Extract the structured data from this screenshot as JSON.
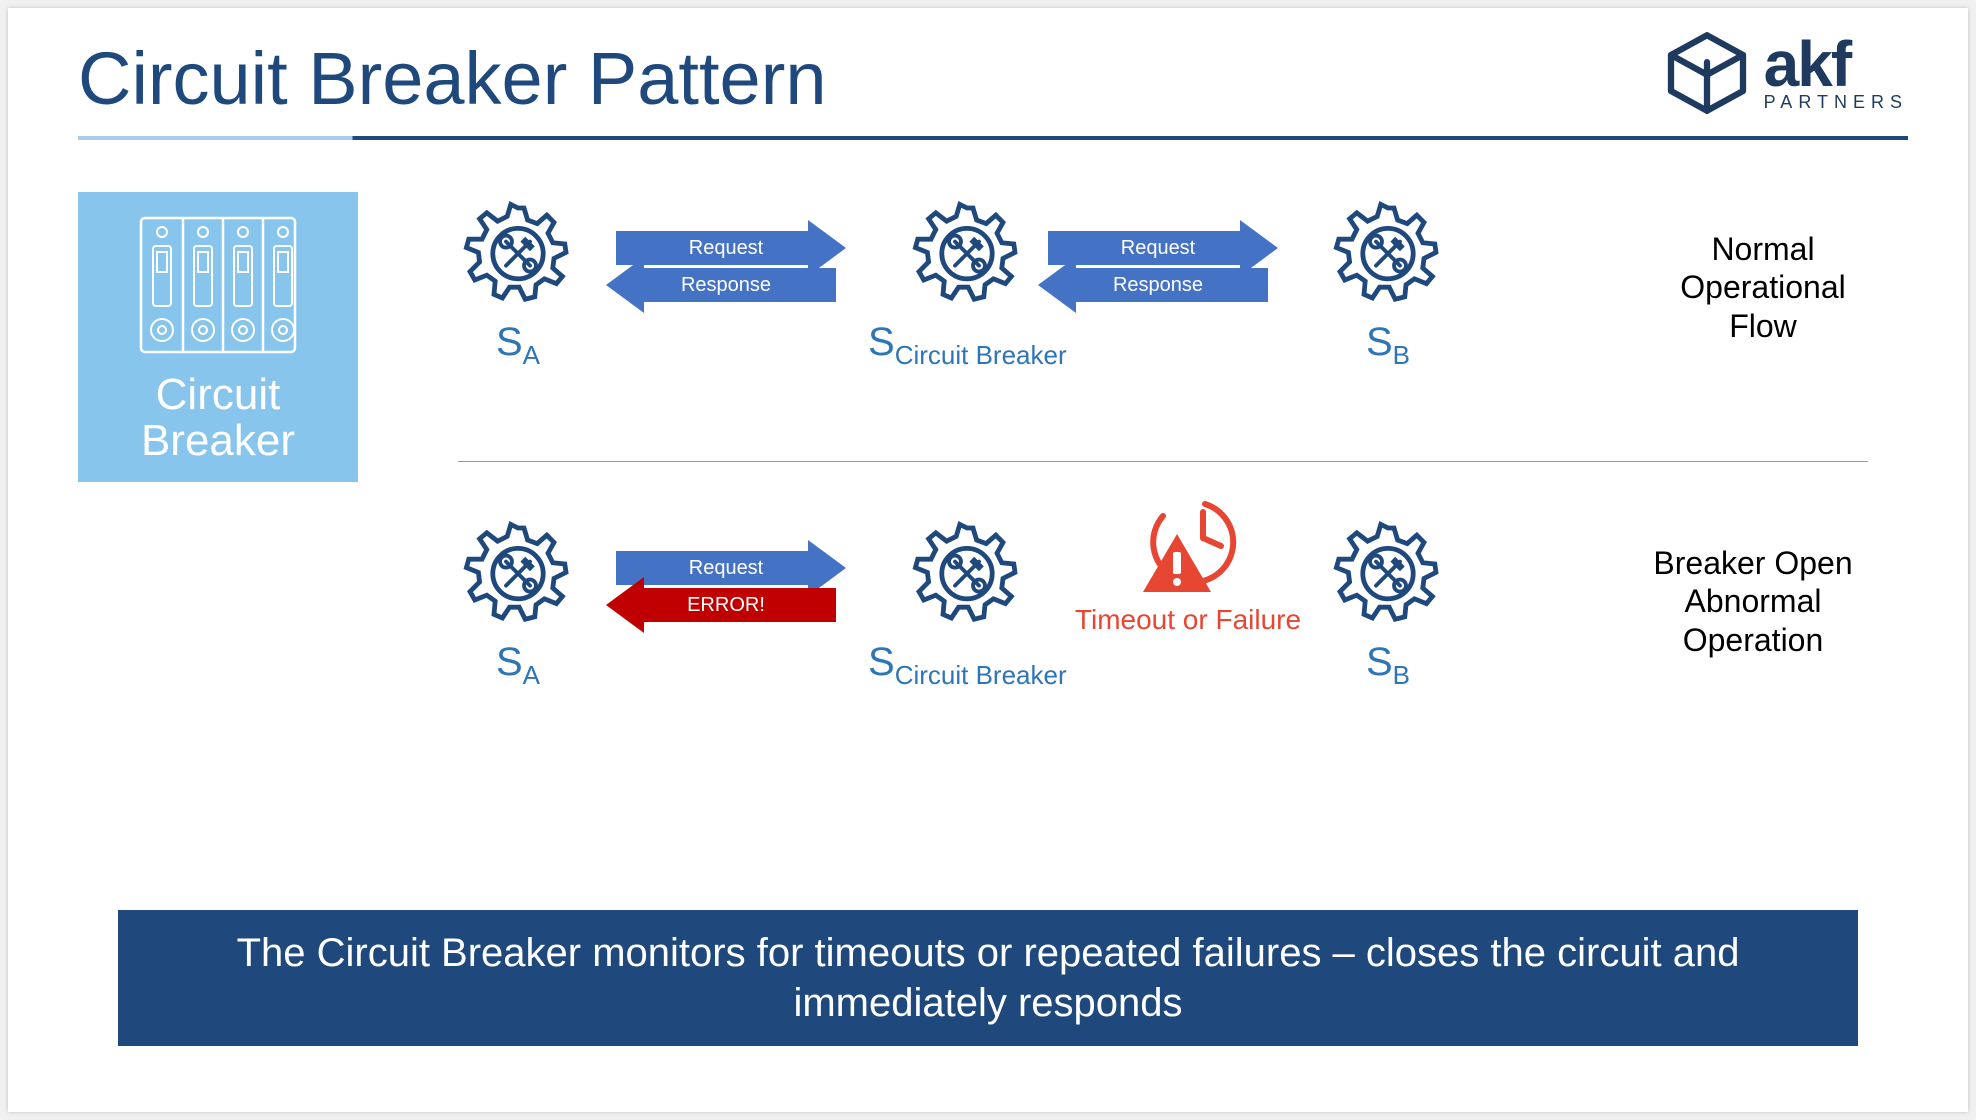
{
  "title": "Circuit Breaker Pattern",
  "brand": {
    "name": "akf",
    "sub": "PARTNERS"
  },
  "sidebar": {
    "label_line1": "Circuit",
    "label_line2": "Breaker"
  },
  "colors": {
    "primary": "#1f497d",
    "accent": "#4472c4",
    "light": "#87c5ec",
    "error": "#c00000",
    "warn": "#e64632"
  },
  "normal": {
    "nodes": {
      "a": {
        "main": "S",
        "sub": "A"
      },
      "cb": {
        "main": "S",
        "sub": "Circuit Breaker"
      },
      "b": {
        "main": "S",
        "sub": "B"
      }
    },
    "arrows1": {
      "top": "Request",
      "bottom": "Response"
    },
    "arrows2": {
      "top": "Request",
      "bottom": "Response"
    },
    "caption_l1": "Normal",
    "caption_l2": "Operational",
    "caption_l3": "Flow"
  },
  "abnormal": {
    "nodes": {
      "a": {
        "main": "S",
        "sub": "A"
      },
      "cb": {
        "main": "S",
        "sub": "Circuit Breaker"
      },
      "b": {
        "main": "S",
        "sub": "B"
      }
    },
    "arrows": {
      "top": "Request",
      "bottom": "ERROR!"
    },
    "timeout_label": "Timeout or Failure",
    "caption_l1": "Breaker Open",
    "caption_l2": "Abnormal",
    "caption_l3": "Operation"
  },
  "footer": "The Circuit Breaker monitors for timeouts or repeated failures – closes the circuit and immediately responds"
}
